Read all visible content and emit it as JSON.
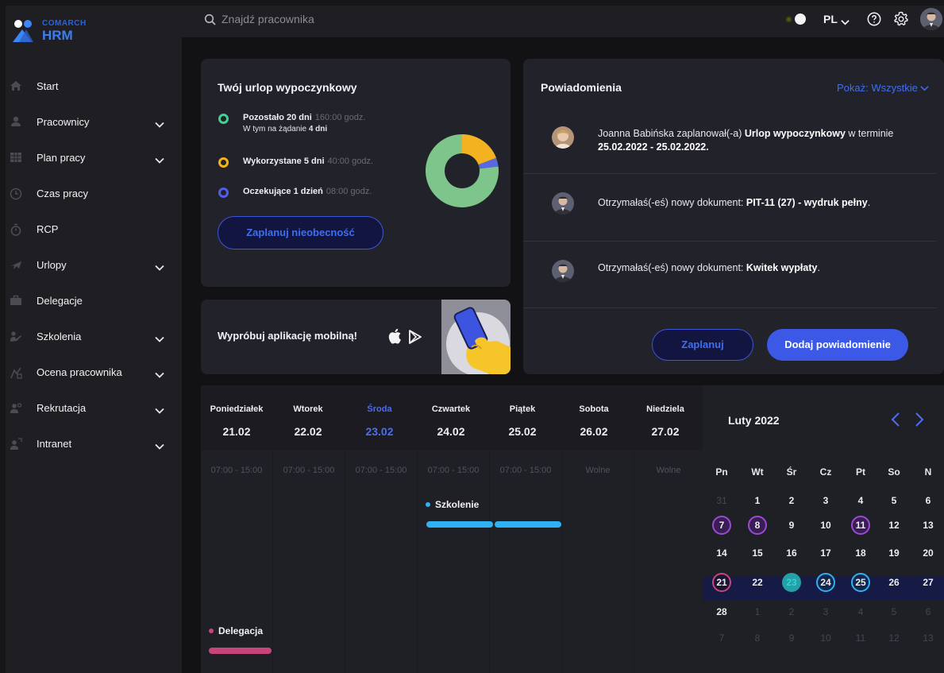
{
  "brand": {
    "top": "COMARCH",
    "bottom": "HRM"
  },
  "search": {
    "placeholder": "Znajdź pracownika"
  },
  "topbar": {
    "lang": "PL"
  },
  "nav": [
    {
      "label": "Start",
      "icon": "home-icon",
      "expandable": false
    },
    {
      "label": "Pracownicy",
      "icon": "users-icon",
      "expandable": true
    },
    {
      "label": "Plan pracy",
      "icon": "grid-icon",
      "expandable": true
    },
    {
      "label": "Czas pracy",
      "icon": "clock-icon",
      "expandable": false
    },
    {
      "label": "RCP",
      "icon": "stopwatch-icon",
      "expandable": false
    },
    {
      "label": "Urlopy",
      "icon": "plane-icon",
      "expandable": true
    },
    {
      "label": "Delegacje",
      "icon": "briefcase-icon",
      "expandable": false
    },
    {
      "label": "Szkolenia",
      "icon": "training-icon",
      "expandable": true
    },
    {
      "label": "Ocena pracownika",
      "icon": "rating-icon",
      "expandable": true
    },
    {
      "label": "Rekrutacja",
      "icon": "recruitment-icon",
      "expandable": true
    },
    {
      "label": "Intranet",
      "icon": "intranet-icon",
      "expandable": true
    }
  ],
  "vacation": {
    "title": "Twój urlop wypoczynkowy",
    "remaining": {
      "label": "Pozostało 20 dni",
      "hours": "160:00 godz.",
      "sub_prefix": "W tym na żądanie",
      "sub_value": "4 dni",
      "color": "#3ed38e"
    },
    "used": {
      "label": "Wykorzystane 5 dni",
      "hours": "40:00 godz.",
      "color": "#f5b316"
    },
    "pending": {
      "label": "Oczekujące 1 dzień",
      "hours": "08:00 godz.",
      "color": "#4f5fe8"
    },
    "button": "Zaplanuj nieobecność",
    "chart": {
      "remaining_days": 20,
      "used_days": 5,
      "pending_days": 1
    }
  },
  "mobile": {
    "text": "Wypróbuj aplikację mobilną!"
  },
  "notifications": {
    "title": "Powiadomienia",
    "filter": "Pokaż: Wszystkie",
    "items": [
      {
        "text_a": "Joanna Babińska zaplanował(-a) ",
        "bold_a": "Urlop wypoczynkowy",
        "text_b": " w terminie ",
        "bold_b": "25.02.2022 - 25.02.2022."
      },
      {
        "text_a": "Otrzymałaś(-eś) nowy dokument: ",
        "bold_a": "PIT-11 (27) - wydruk pełny",
        "text_b": ".",
        "bold_b": ""
      },
      {
        "text_a": "Otrzymałaś(-eś) nowy dokument: ",
        "bold_a": "Kwitek wypłaty",
        "text_b": ".",
        "bold_b": ""
      }
    ],
    "plan_button": "Zaplanuj",
    "add_button": "Dodaj powiadomienie"
  },
  "week": {
    "days": [
      {
        "name": "Poniedziałek",
        "date": "21.02",
        "hours": "07:00 - 15:00"
      },
      {
        "name": "Wtorek",
        "date": "22.02",
        "hours": "07:00 - 15:00"
      },
      {
        "name": "Środa",
        "date": "23.02",
        "hours": "07:00 - 15:00"
      },
      {
        "name": "Czwartek",
        "date": "24.02",
        "hours": "07:00 - 15:00"
      },
      {
        "name": "Piątek",
        "date": "25.02",
        "hours": "07:00 - 15:00"
      },
      {
        "name": "Sobota",
        "date": "26.02",
        "hours": "Wolne"
      },
      {
        "name": "Niedziela",
        "date": "27.02",
        "hours": "Wolne"
      }
    ],
    "events": {
      "training": {
        "label": "Szkolenie",
        "color": "#2fb1f5"
      },
      "delegation": {
        "label": "Delegacja",
        "color": "#c8457c"
      }
    }
  },
  "calendar": {
    "title": "Luty 2022",
    "weekdays": [
      "Pn",
      "Wt",
      "Śr",
      "Cz",
      "Pt",
      "So",
      "N"
    ],
    "rows": [
      [
        "31",
        "1",
        "2",
        "3",
        "4",
        "5",
        "6"
      ],
      [
        "7",
        "8",
        "9",
        "10",
        "11",
        "12",
        "13"
      ],
      [
        "14",
        "15",
        "16",
        "17",
        "18",
        "19",
        "20"
      ],
      [
        "21",
        "22",
        "23",
        "24",
        "25",
        "26",
        "27"
      ],
      [
        "28",
        "1",
        "2",
        "3",
        "4",
        "5",
        "6"
      ],
      [
        "7",
        "8",
        "9",
        "10",
        "11",
        "12",
        "13"
      ]
    ]
  }
}
